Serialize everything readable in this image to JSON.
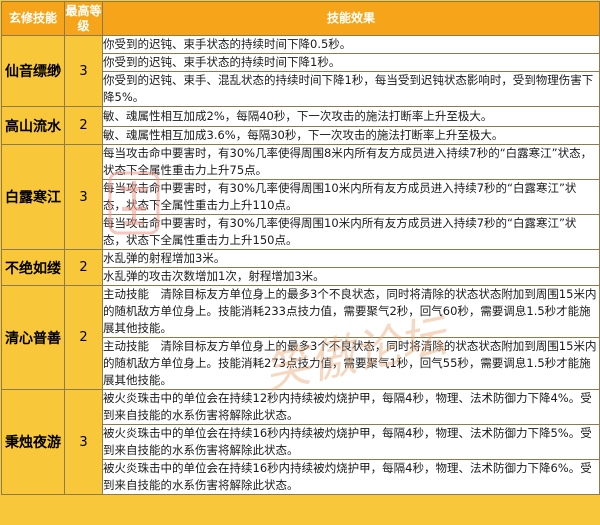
{
  "header": {
    "col_name": "玄修技能",
    "col_level": "最高等级",
    "col_effect": "技能效果"
  },
  "skills": [
    {
      "name": "仙音缥缈",
      "max_level": "3",
      "effects": [
        "你受到的迟钝、束手状态的持续时间下降0.5秒。",
        "你受到的迟钝、束手状态的持续时间下降1秒。",
        "你受到的迟钝、束手、混乱状态的持续时间下降1秒，每当受到迟钝状态影响时，受到物理伤害下降5%。"
      ]
    },
    {
      "name": "高山流水",
      "max_level": "2",
      "effects": [
        "敏、魂属性相互加成2%，每隔40秒，下一次攻击的施法打断率上升至极大。",
        "敏、魂属性相互加成3.6%，每隔30秒，下一次攻击的施法打断率上升至极大。"
      ]
    },
    {
      "name": "白露寒江",
      "max_level": "3",
      "effects": [
        "每当攻击命中要害时，有30%几率使得周围8米内所有友方成员进入持续7秒的“白露寒江”状态，状态下全属性重击力上升75点。",
        "每当攻击命中要害时，有30%几率使得周围10米内所有友方成员进入持续7秒的“白露寒江”状态，状态下全属性重击力上升110点。",
        "每当攻击命中要害时，有30%几率使得周围10米内所有友方成员进入持续7秒的“白露寒江”状态，状态下全属性重击力上升150点。"
      ]
    },
    {
      "name": "不绝如缕",
      "max_level": "2",
      "effects": [
        "水乱弹的射程增加3米。",
        "水乱弹的攻击次数增加1次，射程增加3米。"
      ]
    },
    {
      "name": "清心普善",
      "max_level": "2",
      "effects": [
        "主动技能　清除目标友方单位身上的最多3个不良状态，同时将清除的状态状态附加到周围15米内的随机敌方单位身上。技能消耗233点技力值，需要聚气2秒，回气60秒，需要调息1.5秒才能施展其他技能。",
        "主动技能　清除目标友方单位身上的最多3个不良状态，同时将清除的状态状态附加到周围15米内的随机敌方单位身上。技能消耗273点技力值，需要聚气1秒，回气55秒，需要调息1.5秒才能施展其他技能。"
      ]
    },
    {
      "name": "秉烛夜游",
      "max_level": "3",
      "effects": [
        "被火炎珠击中的单位会在持续12秒内持续被灼烧护甲，每隔4秒，物理、法术防御力下降4%。受到来自技能的水系伤害将解除此状态。",
        "被火炎珠击中的单位会在持续16秒内持续被灼烧护甲，每隔4秒，物理、法术防御力下降5%。受到来自技能的水系伤害将解除此状态。",
        "被火炎珠击中的单位会在持续16秒内持续被灼烧护甲，每隔4秒，物理、法术防御力下降6%。受到来自技能的水系伤害将解除此状态。"
      ]
    }
  ],
  "watermark": {
    "logo_icon": "tianshu-seal-icon",
    "text": "笑傲论坛",
    "color": "#e9aa7a"
  }
}
